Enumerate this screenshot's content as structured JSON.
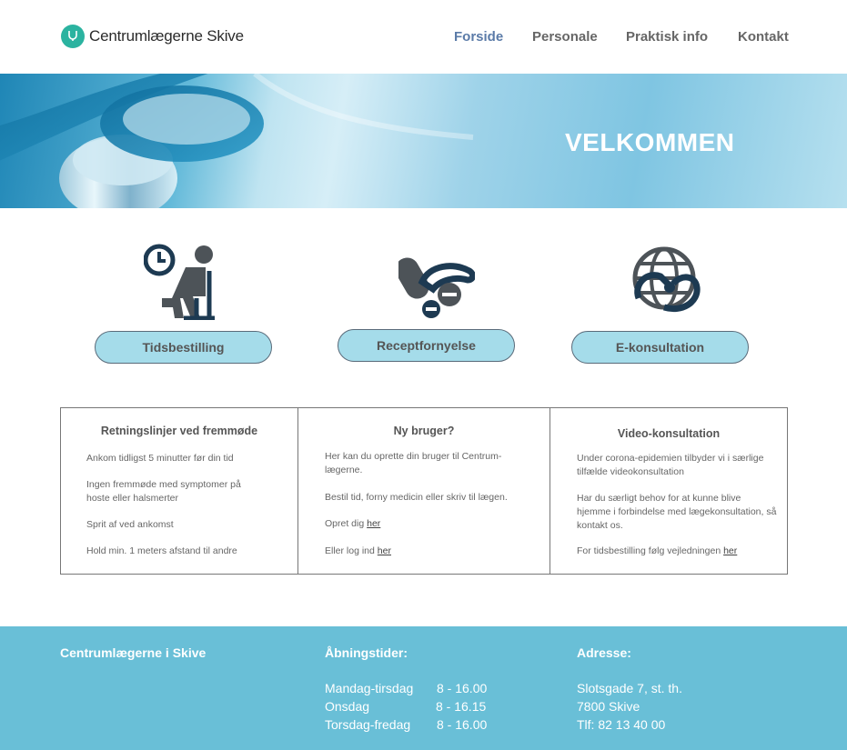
{
  "header": {
    "brand": "Centrumlægerne Skive",
    "nav": [
      "Forside",
      "Personale",
      "Praktisk info",
      "Kontakt"
    ]
  },
  "hero": {
    "title": "VELKOMMEN"
  },
  "services": [
    {
      "label": "Tidsbestilling",
      "icon": "waiting-room-clock-icon"
    },
    {
      "label": "Receptfornyelse",
      "icon": "pills-icon"
    },
    {
      "label": "E-konsultation",
      "icon": "globe-stethoscope-icon"
    }
  ],
  "info": {
    "col1": {
      "title": "Retningslinjer ved fremmøde",
      "lines": [
        "Ankom tidligst 5 minutter før din tid",
        "Ingen fremmøde med symptomer på hoste eller halsmerter",
        "Sprit af ved ankomst",
        "Hold min. 1 meters afstand til andre"
      ]
    },
    "col2": {
      "title": "Ny bruger?",
      "p1": "Her kan du oprette din bruger til Centrum-lægerne.",
      "p2": "Bestil tid, forny medicin eller skriv til lægen.",
      "p3": "Opret dig",
      "p3_link": "her",
      "p4": "Eller log ind",
      "p4_link": "her"
    },
    "col3": {
      "title": "Video-konsultation",
      "p1": "Under corona-epidemien tilbyder vi i særlige tilfælde videokonsultation",
      "p2": "Har du særligt behov for at kunne blive hjemme i forbindelse med lægekonsultation, så kontakt os.",
      "p3": "For tidsbestilling følg vejledningen",
      "p3_link": "her"
    }
  },
  "footer": {
    "name": "Centrumlægerne i Skive",
    "hours_title": "Åbningstider:",
    "hours": [
      {
        "day": "Mandag-tirsdag",
        "time": "8 - 16.00"
      },
      {
        "day": "Onsdag",
        "time": "8 - 16.15"
      },
      {
        "day": "Torsdag-fredag",
        "time": "8 - 16.00"
      }
    ],
    "address_title": "Adresse:",
    "address": [
      "Slotsgade 7, st. th.",
      "7800 Skive",
      "Tlf: 82 13 40 00"
    ]
  },
  "colors": {
    "accent_teal": "#2bb3a0",
    "nav_active": "#5b7ba8",
    "button_bg": "#a5dcea",
    "icon_dark": "#1d3a52",
    "icon_gray": "#4d5358",
    "footer_bg": "#69bfd7"
  }
}
